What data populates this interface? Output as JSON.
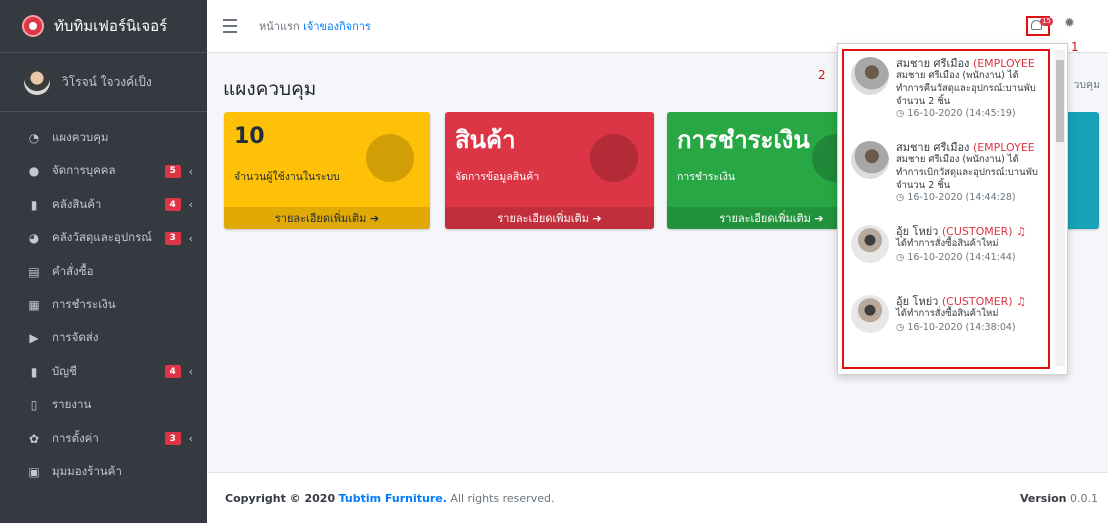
{
  "brand": {
    "name": "ทับทิมเฟอร์นิเจอร์"
  },
  "user": {
    "name": "วิโรจน์ ใจวงค์เป็ง"
  },
  "sidebar": {
    "items": [
      {
        "label": "แผงควบคุม",
        "icon": "dashboard-icon"
      },
      {
        "label": "จัดการบุคคล",
        "icon": "user-circle-icon",
        "badge": "5"
      },
      {
        "label": "คลังสินค้า",
        "icon": "copy-icon",
        "badge": "4"
      },
      {
        "label": "คลังวัสดุและอุปกรณ์",
        "icon": "pie-chart-icon",
        "badge": "3"
      },
      {
        "label": "คำสั่งซื้อ",
        "icon": "list-icon"
      },
      {
        "label": "การชำระเงิน",
        "icon": "cash-register-icon"
      },
      {
        "label": "การจัดส่ง",
        "icon": "truck-icon"
      },
      {
        "label": "บัญชี",
        "icon": "copy-icon",
        "badge": "4"
      },
      {
        "label": "รายงาน",
        "icon": "file-icon"
      },
      {
        "label": "การตั้งค่า",
        "icon": "cogs-icon",
        "badge": "3"
      },
      {
        "label": "มุมมองร้านค้า",
        "icon": "store-icon"
      }
    ]
  },
  "header": {
    "breadcrumb_home": "หน้าแรก",
    "breadcrumb_current": "เจ้าของกิจการ",
    "notification_count": "15",
    "annotation_1": "1",
    "annotation_2": "2"
  },
  "main": {
    "title": "แผงควบคุม",
    "breadcrumb_right": "วบคุม",
    "boxes": [
      {
        "value": "10",
        "subtitle": "จำนวนผู้ใช้งานในระบบ",
        "footer": "รายละเอียดเพิ่มเติม",
        "color": "#ffc107"
      },
      {
        "value": "สินค้า",
        "subtitle": "จัดการข้อมูลสินค้า",
        "footer": "รายละเอียดเพิ่มเติม",
        "color": "#dc3545"
      },
      {
        "value": "การชำระเงิน",
        "subtitle": "การชำระเงิน",
        "footer": "รายละเอียดเพิ่มเติม",
        "color": "#28a745"
      }
    ]
  },
  "notifications": [
    {
      "name": "สมชาย ศรีเมือง",
      "role": "(EMPLOYEE",
      "message": "สมชาย ศรีเมือง (พนักงาน) ได้ทำการคืนวัสดุและอุปกรณ์:บานพับ จำนวน 2 ชิ้น",
      "time": "16-10-2020 (14:45:19)"
    },
    {
      "name": "สมชาย ศรีเมือง",
      "role": "(EMPLOYEE",
      "message": "สมชาย ศรีเมือง (พนักงาน) ได้ทำการเบิกวัสดุและอุปกรณ์:บานพับ จำนวน 2 ชิ้น",
      "time": "16-10-2020 (14:44:28)"
    },
    {
      "name": "อุ้ย โหย่ว",
      "role": "(CUSTOMER)",
      "message": "ได้ทำการสั่งซื้อสินค้าใหม่",
      "time": "16-10-2020 (14:41:44)"
    },
    {
      "name": "อุ้ย โหย่ว",
      "role": "(CUSTOMER)",
      "message": "ได้ทำการสั่งซื้อสินค้าใหม่",
      "time": "16-10-2020 (14:38:04)"
    }
  ],
  "footer": {
    "copyright_prefix": "Copyright © 2020",
    "brand": "Tubtim Furniture.",
    "suffix": "All rights reserved.",
    "version_label": "Version",
    "version": "0.0.1"
  }
}
